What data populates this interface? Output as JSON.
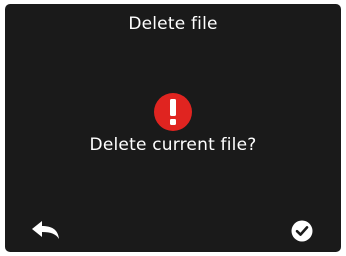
{
  "dialog": {
    "title": "Delete file",
    "message": "Delete current file?",
    "warning_icon": "exclamation-circle-icon",
    "warning_color": "#e02420"
  },
  "actions": {
    "back_icon": "back-arrow-icon",
    "confirm_icon": "check-circle-icon"
  },
  "colors": {
    "background": "#1a1a1a",
    "text": "#ffffff"
  }
}
